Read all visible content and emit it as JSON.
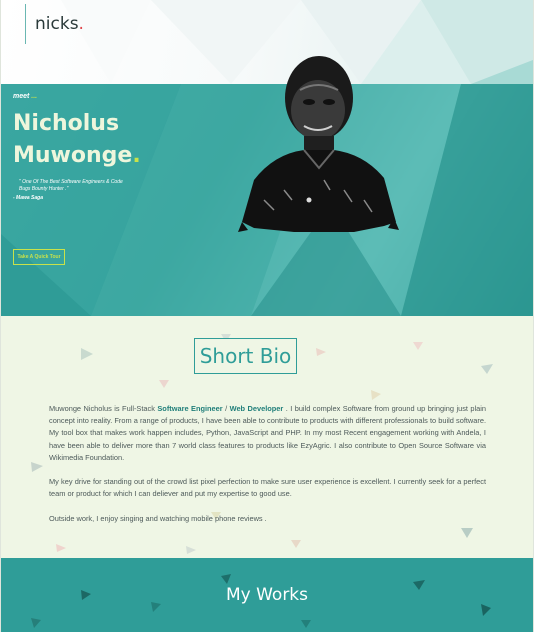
{
  "header": {
    "logo_text": "nicks",
    "logo_dot": "."
  },
  "hero": {
    "kicker": "meet",
    "kicker_dots": "...",
    "first_name": "Nicholus",
    "last_name": "Muwonge",
    "name_dot": ".",
    "quote": "\" One Of The Best Software Engineers & Code Bugs Bounty Hunter .\"",
    "quote_author": "- Mawa Saga",
    "cta_label": "Take A Quick Tour"
  },
  "bio": {
    "title": "Short Bio",
    "p1_a": "Muwonge Nicholus is Full-Stack ",
    "p1_role1": "Software Engineer",
    "p1_sep": " / ",
    "p1_role2": "Web Developer",
    "p1_b": " . I build complex Software from ground up bringing just plain concept into reality. From a range of products, I have been able to contribute to products with different professionals to build software. My tool box that makes work happen includes, Python, JavaScript and PHP. In my most Recent engagement working with Andela, I have been able to deliver more than 7 world class features to products like EzyAgric. I also contribute to Open Source Software via Wikimedia Foundation.",
    "p2": "My key drive for standing out of the crowd list pixel perfection to make sure user experience is excellent. I currently seek for a perfect team or product for which I can deliever and put my expertise to good use.",
    "p3": "Outside work, I enjoy singing and watching mobile phone reviews ."
  },
  "works": {
    "title": "My Works"
  },
  "colors": {
    "teal": "#2f9d98",
    "accent_lime": "#c8e24a",
    "logo_dot_red": "#e0474c",
    "bio_bg": "#eff6e5"
  }
}
